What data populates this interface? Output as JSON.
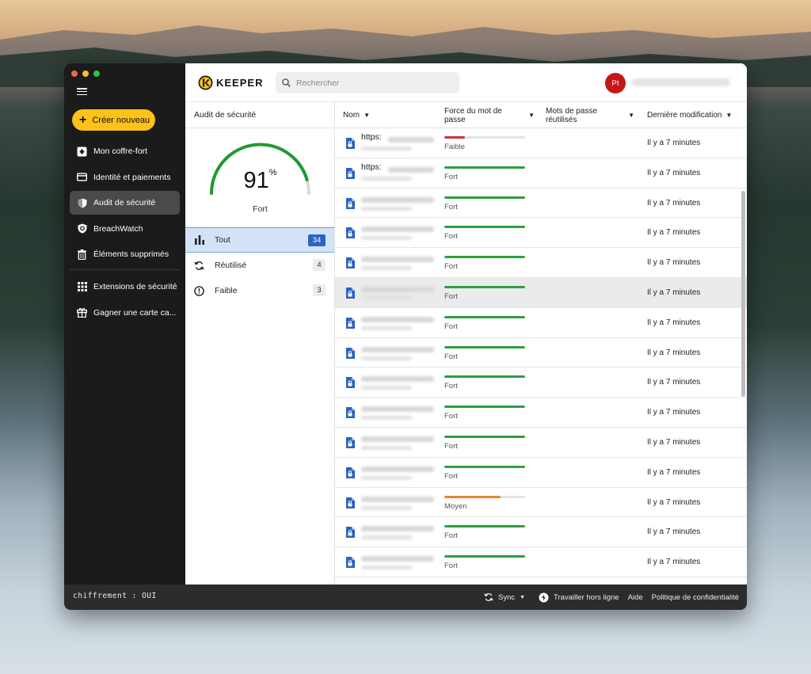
{
  "sidebar": {
    "create_label": "Créer nouveau",
    "items": [
      {
        "label": "Mon coffre-fort",
        "icon": "vault-icon"
      },
      {
        "label": "Identité et paiements",
        "icon": "card-icon"
      },
      {
        "label": "Audit de sécurité",
        "icon": "shield-icon",
        "active": true
      },
      {
        "label": "BreachWatch",
        "icon": "breachwatch-icon"
      },
      {
        "label": "Éléments supprimés",
        "icon": "trash-icon"
      },
      {
        "label": "Extensions de sécurité",
        "icon": "grid-icon"
      },
      {
        "label": "Gagner une carte ca...",
        "icon": "gift-icon"
      }
    ]
  },
  "topbar": {
    "logo_text": "KEEPER",
    "search_placeholder": "Rechercher",
    "avatar_initials": "PI"
  },
  "audit": {
    "header": "Audit de sécurité",
    "score": "91",
    "score_unit": "%",
    "score_fraction": 0.91,
    "score_label": "Fort",
    "filters": [
      {
        "label": "Tout",
        "count": "34",
        "icon": "bar-chart-icon",
        "active": true
      },
      {
        "label": "Réutilisé",
        "count": "4",
        "icon": "refresh-icon"
      },
      {
        "label": "Faible",
        "count": "3",
        "icon": "alert-icon"
      }
    ]
  },
  "table": {
    "columns": {
      "name": "Nom",
      "strength": "Force du mot de passe",
      "reused": "Mots de passe réutilisés",
      "modified": "Dernière modification"
    },
    "rows": [
      {
        "name_prefix": "https:",
        "strength": "Faible",
        "level": 0.25,
        "color": "#d32f2f",
        "modified": "Il y a 7 minutes"
      },
      {
        "name_prefix": "https:",
        "strength": "Fort",
        "level": 1,
        "color": "#2e9e3e",
        "modified": "Il y a 7 minutes"
      },
      {
        "name_prefix": "",
        "strength": "Fort",
        "level": 1,
        "color": "#2e9e3e",
        "modified": "Il y a 7 minutes"
      },
      {
        "name_prefix": "",
        "strength": "Fort",
        "level": 1,
        "color": "#2e9e3e",
        "modified": "Il y a 7 minutes"
      },
      {
        "name_prefix": "",
        "strength": "Fort",
        "level": 1,
        "color": "#2e9e3e",
        "modified": "Il y a 7 minutes"
      },
      {
        "name_prefix": "",
        "strength": "Fort",
        "level": 1,
        "color": "#2e9e3e",
        "modified": "Il y a 7 minutes",
        "highlight": true
      },
      {
        "name_prefix": "",
        "strength": "Fort",
        "level": 1,
        "color": "#2e9e3e",
        "modified": "Il y a 7 minutes"
      },
      {
        "name_prefix": "",
        "strength": "Fort",
        "level": 1,
        "color": "#2e9e3e",
        "modified": "Il y a 7 minutes"
      },
      {
        "name_prefix": "",
        "strength": "Fort",
        "level": 1,
        "color": "#2e9e3e",
        "modified": "Il y a 7 minutes"
      },
      {
        "name_prefix": "",
        "strength": "Fort",
        "level": 1,
        "color": "#2e9e3e",
        "modified": "Il y a 7 minutes"
      },
      {
        "name_prefix": "",
        "strength": "Fort",
        "level": 1,
        "color": "#2e9e3e",
        "modified": "Il y a 7 minutes"
      },
      {
        "name_prefix": "",
        "strength": "Fort",
        "level": 1,
        "color": "#2e9e3e",
        "modified": "Il y a 7 minutes"
      },
      {
        "name_prefix": "",
        "strength": "Moyen",
        "level": 0.7,
        "color": "#e8862a",
        "modified": "Il y a 7 minutes"
      },
      {
        "name_prefix": "",
        "strength": "Fort",
        "level": 1,
        "color": "#2e9e3e",
        "modified": "Il y a 7 minutes"
      },
      {
        "name_prefix": "",
        "strength": "Fort",
        "level": 1,
        "color": "#2e9e3e",
        "modified": "Il y a 7 minutes"
      }
    ]
  },
  "footer": {
    "encryption": "chiffrement : OUI",
    "sync": "Sync",
    "offline": "Travailler hors ligne",
    "help": "Aide",
    "privacy": "Politique de confidentialité"
  },
  "colors": {
    "accent_yellow": "#ffc21a",
    "active_blue": "#2b63c2",
    "gauge_green": "#1f9a34"
  }
}
